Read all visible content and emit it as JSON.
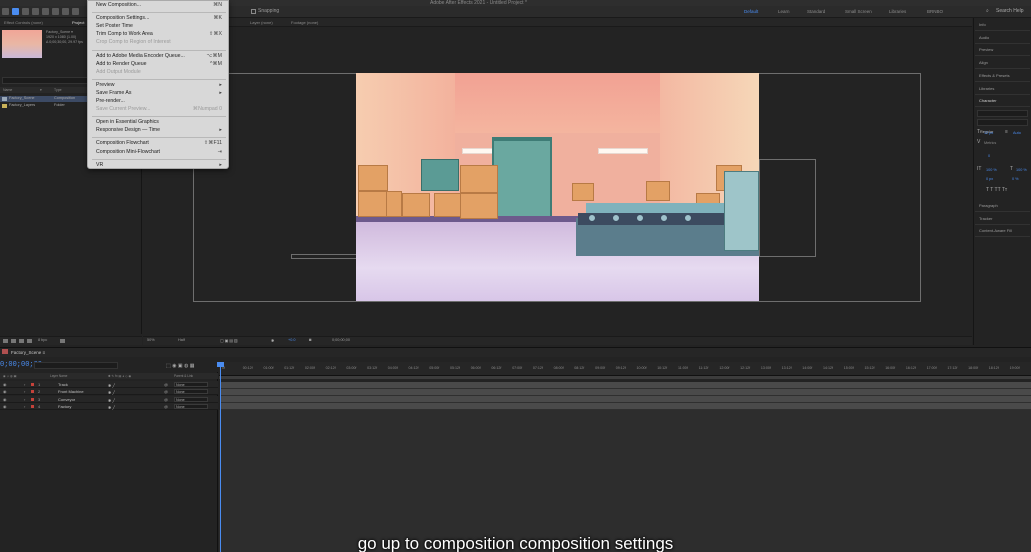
{
  "app": {
    "title": "Adobe After Effects 2021 - Untitled Project *",
    "search_help": "Search Help",
    "snapping": "Snapping",
    "workspaces": [
      "Default",
      "Learn",
      "Standard",
      "Small Screen",
      "Libraries",
      "BRNBO"
    ]
  },
  "menu": {
    "items": [
      {
        "label": "New Composition...",
        "shortcut": "⌘N",
        "disabled": false,
        "sep_before": false
      },
      {
        "label": "Composition Settings...",
        "shortcut": "⌘K",
        "disabled": false,
        "sep_before": true
      },
      {
        "label": "Set Poster Time",
        "shortcut": "",
        "disabled": false,
        "sep_before": false
      },
      {
        "label": "Trim Comp to Work Area",
        "shortcut": "⇧⌘X",
        "disabled": false,
        "sep_before": false
      },
      {
        "label": "Crop Comp to Region of Interest",
        "shortcut": "",
        "disabled": true,
        "sep_before": false
      },
      {
        "label": "Add to Adobe Media Encoder Queue...",
        "shortcut": "⌥⌘M",
        "disabled": false,
        "sep_before": true
      },
      {
        "label": "Add to Render Queue",
        "shortcut": "^⌘M",
        "disabled": false,
        "sep_before": false
      },
      {
        "label": "Add Output Module",
        "shortcut": "",
        "disabled": true,
        "sep_before": false
      },
      {
        "label": "Preview",
        "shortcut": "▸",
        "disabled": false,
        "sep_before": true
      },
      {
        "label": "Save Frame As",
        "shortcut": "▸",
        "disabled": false,
        "sep_before": false
      },
      {
        "label": "Pre-render...",
        "shortcut": "",
        "disabled": false,
        "sep_before": false
      },
      {
        "label": "Save Current Preview...",
        "shortcut": "⌘Numpad 0",
        "disabled": true,
        "sep_before": false
      },
      {
        "label": "Open in Essential Graphics",
        "shortcut": "",
        "disabled": false,
        "sep_before": true
      },
      {
        "label": "Responsive Design — Time",
        "shortcut": "▸",
        "disabled": false,
        "sep_before": false
      },
      {
        "label": "Composition Flowchart",
        "shortcut": "⇧⌘F11",
        "disabled": false,
        "sep_before": true
      },
      {
        "label": "Composition Mini-Flowchart",
        "shortcut": "⇥",
        "disabled": false,
        "sep_before": false
      },
      {
        "label": "VR",
        "shortcut": "▸",
        "disabled": false,
        "sep_before": true
      }
    ]
  },
  "project": {
    "tabs": [
      "Effect Controls (none)",
      "Project"
    ],
    "thumb_info": [
      "Factory_Scene ▾",
      "1920 x 1080 (1.00)",
      "Δ 0;00;30;00, 29.97 fps"
    ],
    "columns": [
      "Name",
      "▾",
      "Type"
    ],
    "items": [
      {
        "name": "Factory_Scene",
        "type": "Composition",
        "kind": "comp",
        "selected": true
      },
      {
        "name": "Factory_Layers",
        "type": "Folder",
        "kind": "folder",
        "selected": false
      }
    ],
    "bottom_label": "8 bpc"
  },
  "viewer": {
    "tabs": [
      "Layer (none)",
      "Footage (none)"
    ],
    "zoom": "50%",
    "resolution": "Half",
    "timecode": "0;00;00;00",
    "camera_value": "+0.0"
  },
  "right_panel": {
    "sections": [
      "Info",
      "Audio",
      "Preview",
      "Align",
      "Effects & Presets",
      "Libraries",
      "Character"
    ],
    "font": "Noto Sans Canadi...",
    "style": "Regular",
    "size": "12 px",
    "leading": "Auto",
    "tracking": "0",
    "kerning": "Metrics",
    "vscale": "100 %",
    "hscale": "100 %",
    "baseline": "0 px",
    "tsume": "0 %",
    "lower_sections": [
      "Paragraph",
      "Tracker",
      "Content-Aware Fill"
    ]
  },
  "timeline": {
    "comp_tab": "Factory_Scene ≡",
    "time": "0;00;00;00",
    "col_headers": [
      "Layer Name",
      "Parent & Link"
    ],
    "layers": [
      {
        "num": "1",
        "name": "Track",
        "parent": "None"
      },
      {
        "num": "2",
        "name": "Front Machine",
        "parent": "None"
      },
      {
        "num": "3",
        "name": "Conveyor",
        "parent": "None"
      },
      {
        "num": "4",
        "name": "Factory",
        "parent": "None"
      }
    ],
    "ticks": [
      "0f",
      "00:12f",
      "01:00f",
      "01:12f",
      "02:00f",
      "02:12f",
      "03:00f",
      "03:12f",
      "04:00f",
      "04:12f",
      "05:00f",
      "05:12f",
      "06:00f",
      "06:12f",
      "07:00f",
      "07:12f",
      "08:00f",
      "08:12f",
      "09:00f",
      "09:12f",
      "10:00f",
      "10:12f",
      "11:00f",
      "11:12f",
      "12:00f",
      "12:12f",
      "13:00f",
      "13:12f",
      "14:00f",
      "14:12f",
      "15:00f",
      "15:12f",
      "16:00f",
      "16:12f",
      "17:00f",
      "17:12f",
      "18:00f",
      "18:12f",
      "19:00f"
    ]
  },
  "subtitle": "go up to composition composition settings",
  "colors": {
    "accent": "#4a8cf0",
    "panel": "#232323",
    "menu_bg": "#d8d8d8",
    "layer_label": "#c5423a"
  }
}
